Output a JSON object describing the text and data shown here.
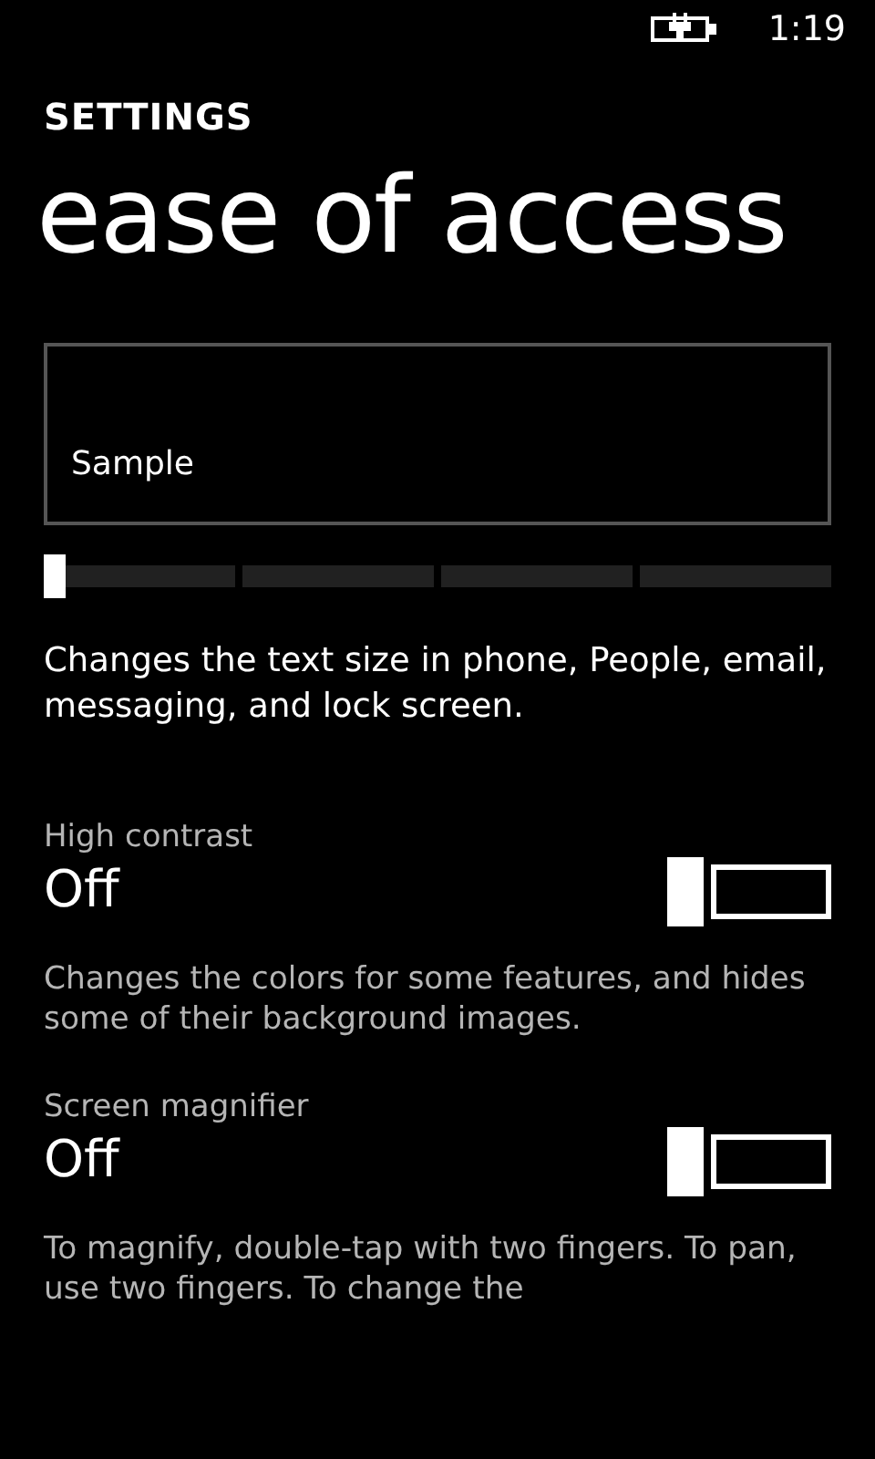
{
  "status_bar": {
    "time": "1:19"
  },
  "header": {
    "app": "SETTINGS",
    "title": "ease of access"
  },
  "text_size": {
    "sample": "Sample",
    "level": 0,
    "description": "Changes the text size in phone, People, email, messaging, and lock screen."
  },
  "settings": [
    {
      "label": "High contrast",
      "value": "Off",
      "on": false,
      "description": "Changes the colors for some features, and hides some of their background images."
    },
    {
      "label": "Screen magnifier",
      "value": "Off",
      "on": false,
      "description": "To magnify, double-tap with two fingers.  To pan, use two fingers.  To change the"
    }
  ]
}
